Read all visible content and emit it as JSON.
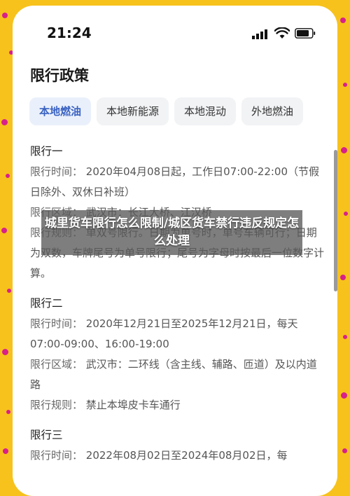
{
  "status_bar": {
    "time": "21:24"
  },
  "page_title": "限行政策",
  "tabs": [
    {
      "label": "本地燃油"
    },
    {
      "label": "本地新能源"
    },
    {
      "label": "本地混动"
    },
    {
      "label": "外地燃油"
    }
  ],
  "sections": [
    {
      "title": "限行一",
      "rules": [
        {
          "label": "限行时间：",
          "text": "2020年04月08日起，工作日07:00-22:00（节假日除外、双休日补班）"
        },
        {
          "label": "限行区域：",
          "text": "武汉市：长江大桥、江汉桥"
        },
        {
          "label": "限行规则：",
          "text": "单双号限行。日期为单号时，单号车辆可行；日期为双数，车牌尾号为单号限行；尾号为字母时按最后一位数字计算。"
        }
      ]
    },
    {
      "title": "限行二",
      "rules": [
        {
          "label": "限行时间：",
          "text": "2020年12月21日至2025年12月21日，每天07:00-09:00、16:00-19:00"
        },
        {
          "label": "限行区域：",
          "text": "武汉市：二环线（含主线、辅路、匝道）及以内道路"
        },
        {
          "label": "限行规则：",
          "text": "禁止本埠皮卡车通行"
        }
      ]
    },
    {
      "title": "限行三",
      "rules": [
        {
          "label": "限行时间：",
          "text": "2022年08月02日至2024年08月02日，每"
        }
      ]
    }
  ],
  "overlay_title": "城里货车限行怎么限制/城区货车禁行违反规定怎么处理",
  "colors": {
    "background": "#f7c21c",
    "dots": "#d8208a",
    "accent": "#3a62c2"
  }
}
